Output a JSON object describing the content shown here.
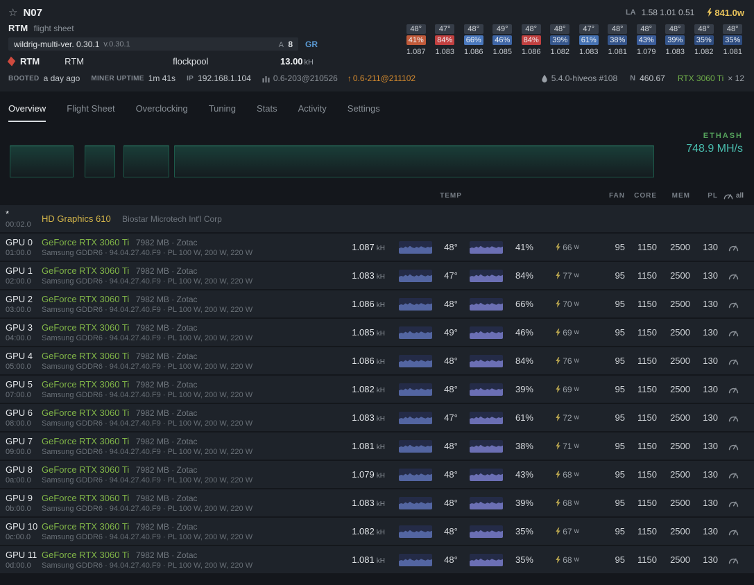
{
  "header": {
    "rig_name": "N07",
    "la_label": "LA",
    "la_values": "1.58 1.01 0.51",
    "power_total": "841.0w"
  },
  "flight_sheet": {
    "name": "RTM",
    "label": "flight sheet",
    "miner": "wildrig-multi-ver. 0.30.1",
    "miner_version": "v.0.30.1",
    "accepted_label": "A",
    "accepted_value": "8",
    "algo": "GR",
    "coin": "RTM",
    "coin_secondary": "RTM",
    "pool": "flockpool",
    "total_hashrate": "13.00",
    "total_hashrate_unit": "kH"
  },
  "mini_grid": {
    "temps": [
      "48°",
      "47°",
      "48°",
      "49°",
      "48°",
      "48°",
      "47°",
      "48°",
      "48°",
      "48°",
      "48°",
      "48°"
    ],
    "fans": [
      "41%",
      "84%",
      "66%",
      "46%",
      "84%",
      "39%",
      "61%",
      "38%",
      "43%",
      "39%",
      "35%",
      "35%"
    ],
    "fan_colors": [
      "#c05a3a",
      "#c14040",
      "#4a78bd",
      "#3f66a6",
      "#c14040",
      "#35568c",
      "#4572b3",
      "#34548a",
      "#3a5c99",
      "#35568c",
      "#2f4d80",
      "#2f4d80"
    ],
    "hashrates": [
      "1.087",
      "1.083",
      "1.086",
      "1.085",
      "1.086",
      "1.082",
      "1.083",
      "1.081",
      "1.079",
      "1.083",
      "1.082",
      "1.081"
    ]
  },
  "status_bar": {
    "booted_label": "BOOTED",
    "booted_value": "a day ago",
    "uptime_label": "MINER UPTIME",
    "uptime_value": "1m 41s",
    "ip_label": "IP",
    "ip_value": "192.168.1.104",
    "agent_version": "0.6-203@210526",
    "agent_update": "0.6-211@211102",
    "os_version": "5.4.0-hiveos #108",
    "n_label": "N",
    "n_value": "460.67",
    "gpu_model": "RTX 3060 Ti",
    "gpu_count": "× 12"
  },
  "tabs": [
    "Overview",
    "Flight Sheet",
    "Overclocking",
    "Tuning",
    "Stats",
    "Activity",
    "Settings"
  ],
  "active_tab": "Overview",
  "chart": {
    "algo_label": "ETHASH",
    "hashrate_value": "748.9 MH/s"
  },
  "sparkline": {
    "points": [
      0.42,
      0.5,
      0.45,
      0.58,
      0.48,
      0.62,
      0.5,
      0.45,
      0.55,
      0.47,
      0.6,
      0.52,
      0.46,
      0.55,
      0.5,
      0.57
    ]
  },
  "table": {
    "headers": {
      "temp": "TEMP",
      "fan": "FAN",
      "core": "CORE",
      "mem": "MEM",
      "pl": "PL",
      "all": "all"
    },
    "integrated": {
      "index": "*",
      "bus": "00:02.0",
      "name": "HD Graphics 610",
      "vendor": "Biostar Microtech Int'l Corp"
    },
    "gpus": [
      {
        "label": "GPU 0",
        "bus": "01:00.0",
        "name": "GeForce RTX 3060 Ti",
        "info": "7982 MB · Zotac",
        "detail": "Samsung GDDR6 · 94.04.27.40.F9 · PL 100 W, 200 W, 220 W",
        "hashrate": "1.087",
        "hash_unit": "kH",
        "temp": "48°",
        "fan": "41%",
        "power": "66",
        "power_unit": "w",
        "fan_set": "95",
        "core": "1150",
        "mem": "2500",
        "pl": "130"
      },
      {
        "label": "GPU 1",
        "bus": "02:00.0",
        "name": "GeForce RTX 3060 Ti",
        "info": "7982 MB · Zotac",
        "detail": "Samsung GDDR6 · 94.04.27.40.F9 · PL 100 W, 200 W, 220 W",
        "hashrate": "1.083",
        "hash_unit": "kH",
        "temp": "47°",
        "fan": "84%",
        "power": "77",
        "power_unit": "w",
        "fan_set": "95",
        "core": "1150",
        "mem": "2500",
        "pl": "130"
      },
      {
        "label": "GPU 2",
        "bus": "03:00.0",
        "name": "GeForce RTX 3060 Ti",
        "info": "7982 MB · Zotac",
        "detail": "Samsung GDDR6 · 94.04.27.40.F9 · PL 100 W, 200 W, 220 W",
        "hashrate": "1.086",
        "hash_unit": "kH",
        "temp": "48°",
        "fan": "66%",
        "power": "70",
        "power_unit": "w",
        "fan_set": "95",
        "core": "1150",
        "mem": "2500",
        "pl": "130"
      },
      {
        "label": "GPU 3",
        "bus": "04:00.0",
        "name": "GeForce RTX 3060 Ti",
        "info": "7982 MB · Zotac",
        "detail": "Samsung GDDR6 · 94.04.27.40.F9 · PL 100 W, 200 W, 220 W",
        "hashrate": "1.085",
        "hash_unit": "kH",
        "temp": "49°",
        "fan": "46%",
        "power": "69",
        "power_unit": "w",
        "fan_set": "95",
        "core": "1150",
        "mem": "2500",
        "pl": "130"
      },
      {
        "label": "GPU 4",
        "bus": "05:00.0",
        "name": "GeForce RTX 3060 Ti",
        "info": "7982 MB · Zotac",
        "detail": "Samsung GDDR6 · 94.04.27.40.F9 · PL 100 W, 200 W, 220 W",
        "hashrate": "1.086",
        "hash_unit": "kH",
        "temp": "48°",
        "fan": "84%",
        "power": "76",
        "power_unit": "w",
        "fan_set": "95",
        "core": "1150",
        "mem": "2500",
        "pl": "130"
      },
      {
        "label": "GPU 5",
        "bus": "07:00.0",
        "name": "GeForce RTX 3060 Ti",
        "info": "7982 MB · Zotac",
        "detail": "Samsung GDDR6 · 94.04.27.40.F9 · PL 100 W, 200 W, 220 W",
        "hashrate": "1.082",
        "hash_unit": "kH",
        "temp": "48°",
        "fan": "39%",
        "power": "69",
        "power_unit": "w",
        "fan_set": "95",
        "core": "1150",
        "mem": "2500",
        "pl": "130"
      },
      {
        "label": "GPU 6",
        "bus": "08:00.0",
        "name": "GeForce RTX 3060 Ti",
        "info": "7982 MB · Zotac",
        "detail": "Samsung GDDR6 · 94.04.27.40.F9 · PL 100 W, 200 W, 220 W",
        "hashrate": "1.083",
        "hash_unit": "kH",
        "temp": "47°",
        "fan": "61%",
        "power": "72",
        "power_unit": "w",
        "fan_set": "95",
        "core": "1150",
        "mem": "2500",
        "pl": "130"
      },
      {
        "label": "GPU 7",
        "bus": "09:00.0",
        "name": "GeForce RTX 3060 Ti",
        "info": "7982 MB · Zotac",
        "detail": "Samsung GDDR6 · 94.04.27.40.F9 · PL 100 W, 200 W, 220 W",
        "hashrate": "1.081",
        "hash_unit": "kH",
        "temp": "48°",
        "fan": "38%",
        "power": "71",
        "power_unit": "w",
        "fan_set": "95",
        "core": "1150",
        "mem": "2500",
        "pl": "130"
      },
      {
        "label": "GPU 8",
        "bus": "0a:00.0",
        "name": "GeForce RTX 3060 Ti",
        "info": "7982 MB · Zotac",
        "detail": "Samsung GDDR6 · 94.04.27.40.F9 · PL 100 W, 200 W, 220 W",
        "hashrate": "1.079",
        "hash_unit": "kH",
        "temp": "48°",
        "fan": "43%",
        "power": "68",
        "power_unit": "w",
        "fan_set": "95",
        "core": "1150",
        "mem": "2500",
        "pl": "130"
      },
      {
        "label": "GPU 9",
        "bus": "0b:00.0",
        "name": "GeForce RTX 3060 Ti",
        "info": "7982 MB · Zotac",
        "detail": "Samsung GDDR6 · 94.04.27.40.F9 · PL 100 W, 200 W, 220 W",
        "hashrate": "1.083",
        "hash_unit": "kH",
        "temp": "48°",
        "fan": "39%",
        "power": "68",
        "power_unit": "w",
        "fan_set": "95",
        "core": "1150",
        "mem": "2500",
        "pl": "130"
      },
      {
        "label": "GPU 10",
        "bus": "0c:00.0",
        "name": "GeForce RTX 3060 Ti",
        "info": "7982 MB · Zotac",
        "detail": "Samsung GDDR6 · 94.04.27.40.F9 · PL 100 W, 200 W, 220 W",
        "hashrate": "1.082",
        "hash_unit": "kH",
        "temp": "48°",
        "fan": "35%",
        "power": "67",
        "power_unit": "w",
        "fan_set": "95",
        "core": "1150",
        "mem": "2500",
        "pl": "130"
      },
      {
        "label": "GPU 11",
        "bus": "0d:00.0",
        "name": "GeForce RTX 3060 Ti",
        "info": "7982 MB · Zotac",
        "detail": "Samsung GDDR6 · 94.04.27.40.F9 · PL 100 W, 200 W, 220 W",
        "hashrate": "1.081",
        "hash_unit": "kH",
        "temp": "48°",
        "fan": "35%",
        "power": "68",
        "power_unit": "w",
        "fan_set": "95",
        "core": "1150",
        "mem": "2500",
        "pl": "130"
      }
    ]
  }
}
